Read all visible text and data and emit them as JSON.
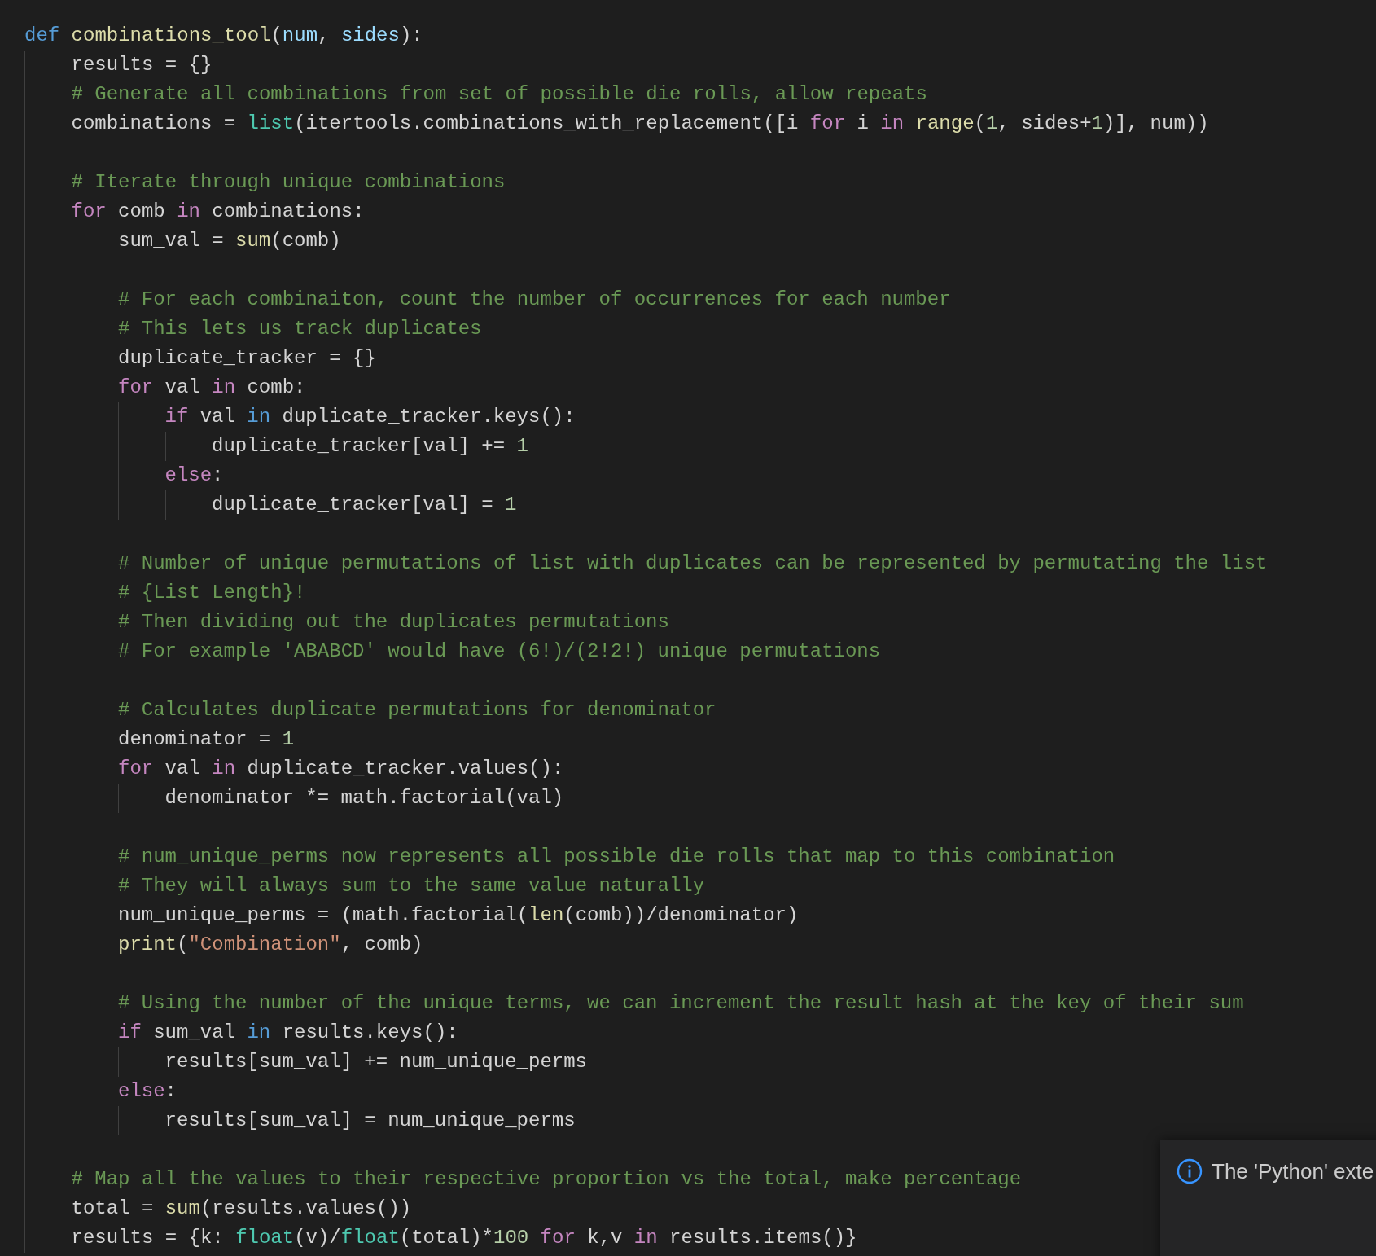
{
  "editor": {
    "lines": [
      {
        "kind": "code",
        "tokens": [
          {
            "kind": "storage",
            "text": "def "
          },
          {
            "kind": "function",
            "text": "combinations_tool"
          },
          {
            "kind": "plain",
            "text": "("
          },
          {
            "kind": "parameter",
            "text": "num"
          },
          {
            "kind": "plain",
            "text": ", "
          },
          {
            "kind": "parameter",
            "text": "sides"
          },
          {
            "kind": "plain",
            "text": "):"
          }
        ],
        "children": [
          {
            "kind": "code",
            "tokens": [
              {
                "kind": "plain",
                "text": "results = {}"
              }
            ]
          },
          {
            "kind": "code",
            "tokens": [
              {
                "kind": "comment",
                "text": "# Generate all combinations from set of possible die rolls, allow repeats"
              }
            ]
          },
          {
            "kind": "code",
            "tokens": [
              {
                "kind": "plain",
                "text": "combinations = "
              },
              {
                "kind": "type",
                "text": "list"
              },
              {
                "kind": "plain",
                "text": "(itertools.combinations_with_replacement([i "
              },
              {
                "kind": "control",
                "text": "for"
              },
              {
                "kind": "plain",
                "text": " i "
              },
              {
                "kind": "control",
                "text": "in "
              },
              {
                "kind": "function",
                "text": "range"
              },
              {
                "kind": "plain",
                "text": "("
              },
              {
                "kind": "number",
                "text": "1"
              },
              {
                "kind": "plain",
                "text": ", sides+"
              },
              {
                "kind": "number",
                "text": "1"
              },
              {
                "kind": "plain",
                "text": ")], num))"
              }
            ]
          },
          {
            "kind": "blank"
          },
          {
            "kind": "code",
            "tokens": [
              {
                "kind": "comment",
                "text": "# Iterate through unique combinations"
              }
            ]
          },
          {
            "kind": "code",
            "tokens": [
              {
                "kind": "control",
                "text": "for"
              },
              {
                "kind": "plain",
                "text": " comb "
              },
              {
                "kind": "control",
                "text": "in"
              },
              {
                "kind": "plain",
                "text": " combinations:"
              }
            ],
            "children": [
              {
                "kind": "code",
                "tokens": [
                  {
                    "kind": "plain",
                    "text": "sum_val = "
                  },
                  {
                    "kind": "function",
                    "text": "sum"
                  },
                  {
                    "kind": "plain",
                    "text": "(comb)"
                  }
                ]
              },
              {
                "kind": "blank"
              },
              {
                "kind": "code",
                "tokens": [
                  {
                    "kind": "comment",
                    "text": "# For each combinaiton, count the number of occurrences for each number"
                  }
                ]
              },
              {
                "kind": "code",
                "tokens": [
                  {
                    "kind": "comment",
                    "text": "# This lets us track duplicates"
                  }
                ]
              },
              {
                "kind": "code",
                "tokens": [
                  {
                    "kind": "plain",
                    "text": "duplicate_tracker = {}"
                  }
                ]
              },
              {
                "kind": "code",
                "tokens": [
                  {
                    "kind": "control",
                    "text": "for"
                  },
                  {
                    "kind": "plain",
                    "text": " val "
                  },
                  {
                    "kind": "control",
                    "text": "in"
                  },
                  {
                    "kind": "plain",
                    "text": " comb:"
                  }
                ],
                "children": [
                  {
                    "kind": "code",
                    "tokens": [
                      {
                        "kind": "control",
                        "text": "if"
                      },
                      {
                        "kind": "plain",
                        "text": " val "
                      },
                      {
                        "kind": "operator",
                        "text": "in"
                      },
                      {
                        "kind": "plain",
                        "text": " duplicate_tracker.keys():"
                      }
                    ],
                    "children": [
                      {
                        "kind": "code",
                        "tokens": [
                          {
                            "kind": "plain",
                            "text": "duplicate_tracker[val] += "
                          },
                          {
                            "kind": "number",
                            "text": "1"
                          }
                        ]
                      }
                    ]
                  },
                  {
                    "kind": "code",
                    "tokens": [
                      {
                        "kind": "control",
                        "text": "else"
                      },
                      {
                        "kind": "plain",
                        "text": ":"
                      }
                    ],
                    "children": [
                      {
                        "kind": "code",
                        "tokens": [
                          {
                            "kind": "plain",
                            "text": "duplicate_tracker[val] = "
                          },
                          {
                            "kind": "number",
                            "text": "1"
                          }
                        ]
                      }
                    ]
                  }
                ]
              },
              {
                "kind": "blank"
              },
              {
                "kind": "code",
                "tokens": [
                  {
                    "kind": "comment",
                    "text": "# Number of unique permutations of list with duplicates can be represented by permutating the list"
                  }
                ]
              },
              {
                "kind": "code",
                "tokens": [
                  {
                    "kind": "comment",
                    "text": "# {List Length}!"
                  }
                ]
              },
              {
                "kind": "code",
                "tokens": [
                  {
                    "kind": "comment",
                    "text": "# Then dividing out the duplicates permutations"
                  }
                ]
              },
              {
                "kind": "code",
                "tokens": [
                  {
                    "kind": "comment",
                    "text": "# For example 'ABABCD' would have (6!)/(2!2!) unique permutations"
                  }
                ]
              },
              {
                "kind": "blank"
              },
              {
                "kind": "code",
                "tokens": [
                  {
                    "kind": "comment",
                    "text": "# Calculates duplicate permutations for denominator"
                  }
                ]
              },
              {
                "kind": "code",
                "tokens": [
                  {
                    "kind": "plain",
                    "text": "denominator = "
                  },
                  {
                    "kind": "number",
                    "text": "1"
                  }
                ]
              },
              {
                "kind": "code",
                "tokens": [
                  {
                    "kind": "control",
                    "text": "for"
                  },
                  {
                    "kind": "plain",
                    "text": " val "
                  },
                  {
                    "kind": "control",
                    "text": "in"
                  },
                  {
                    "kind": "plain",
                    "text": " duplicate_tracker.values():"
                  }
                ],
                "children": [
                  {
                    "kind": "code",
                    "tokens": [
                      {
                        "kind": "plain",
                        "text": "denominator *= math.factorial(val)"
                      }
                    ]
                  }
                ]
              },
              {
                "kind": "blank"
              },
              {
                "kind": "code",
                "tokens": [
                  {
                    "kind": "comment",
                    "text": "# num_unique_perms now represents all possible die rolls that map to this combination"
                  }
                ]
              },
              {
                "kind": "code",
                "tokens": [
                  {
                    "kind": "comment",
                    "text": "# They will always sum to the same value naturally"
                  }
                ]
              },
              {
                "kind": "code",
                "tokens": [
                  {
                    "kind": "plain",
                    "text": "num_unique_perms = (math.factorial("
                  },
                  {
                    "kind": "function",
                    "text": "len"
                  },
                  {
                    "kind": "plain",
                    "text": "(comb))/denominator)"
                  }
                ]
              },
              {
                "kind": "code",
                "tokens": [
                  {
                    "kind": "function",
                    "text": "print"
                  },
                  {
                    "kind": "plain",
                    "text": "("
                  },
                  {
                    "kind": "string",
                    "text": "\"Combination\""
                  },
                  {
                    "kind": "plain",
                    "text": ", comb)"
                  }
                ]
              },
              {
                "kind": "blank"
              },
              {
                "kind": "code",
                "tokens": [
                  {
                    "kind": "comment",
                    "text": "# Using the number of the unique terms, we can increment the result hash at the key of their sum"
                  }
                ]
              },
              {
                "kind": "code",
                "tokens": [
                  {
                    "kind": "control",
                    "text": "if"
                  },
                  {
                    "kind": "plain",
                    "text": " sum_val "
                  },
                  {
                    "kind": "operator",
                    "text": "in"
                  },
                  {
                    "kind": "plain",
                    "text": " results.keys():"
                  }
                ],
                "children": [
                  {
                    "kind": "code",
                    "tokens": [
                      {
                        "kind": "plain",
                        "text": "results[sum_val] += num_unique_perms"
                      }
                    ]
                  }
                ]
              },
              {
                "kind": "code",
                "tokens": [
                  {
                    "kind": "control",
                    "text": "else"
                  },
                  {
                    "kind": "plain",
                    "text": ":"
                  }
                ],
                "children": [
                  {
                    "kind": "code",
                    "tokens": [
                      {
                        "kind": "plain",
                        "text": "results[sum_val] = num_unique_perms"
                      }
                    ]
                  }
                ]
              }
            ]
          },
          {
            "kind": "blank"
          },
          {
            "kind": "code",
            "tokens": [
              {
                "kind": "comment",
                "text": "# Map all the values to their respective proportion vs the total, make percentage"
              }
            ]
          },
          {
            "kind": "code",
            "tokens": [
              {
                "kind": "plain",
                "text": "total = "
              },
              {
                "kind": "function",
                "text": "sum"
              },
              {
                "kind": "plain",
                "text": "(results.values())"
              }
            ]
          },
          {
            "kind": "code",
            "tokens": [
              {
                "kind": "plain",
                "text": "results = {k: "
              },
              {
                "kind": "type",
                "text": "float"
              },
              {
                "kind": "plain",
                "text": "(v)/"
              },
              {
                "kind": "type",
                "text": "float"
              },
              {
                "kind": "plain",
                "text": "(total)*"
              },
              {
                "kind": "number",
                "text": "100"
              },
              {
                "kind": "control",
                "text": " for"
              },
              {
                "kind": "plain",
                "text": " k,v "
              },
              {
                "kind": "control",
                "text": "in"
              },
              {
                "kind": "plain",
                "text": " results.items()}"
              }
            ]
          }
        ]
      }
    ]
  },
  "notification": {
    "kind": "info",
    "message": "The 'Python' exte"
  }
}
